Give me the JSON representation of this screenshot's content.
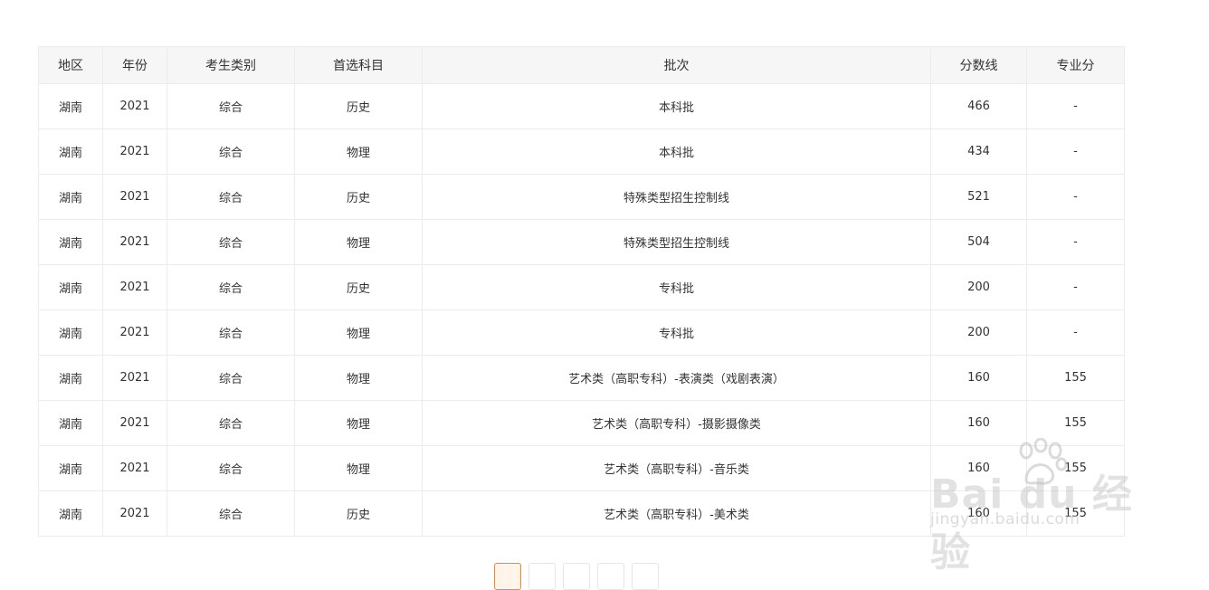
{
  "table": {
    "headers": {
      "region": "地区",
      "year": "年份",
      "type": "考生类别",
      "subject": "首选科目",
      "batch": "批次",
      "score": "分数线",
      "major": "专业分"
    },
    "rows": [
      {
        "region": "湖南",
        "year": "2021",
        "type": "综合",
        "subject": "历史",
        "batch": "本科批",
        "score": "466",
        "major": "-"
      },
      {
        "region": "湖南",
        "year": "2021",
        "type": "综合",
        "subject": "物理",
        "batch": "本科批",
        "score": "434",
        "major": "-"
      },
      {
        "region": "湖南",
        "year": "2021",
        "type": "综合",
        "subject": "历史",
        "batch": "特殊类型招生控制线",
        "score": "521",
        "major": "-"
      },
      {
        "region": "湖南",
        "year": "2021",
        "type": "综合",
        "subject": "物理",
        "batch": "特殊类型招生控制线",
        "score": "504",
        "major": "-"
      },
      {
        "region": "湖南",
        "year": "2021",
        "type": "综合",
        "subject": "历史",
        "batch": "专科批",
        "score": "200",
        "major": "-"
      },
      {
        "region": "湖南",
        "year": "2021",
        "type": "综合",
        "subject": "物理",
        "batch": "专科批",
        "score": "200",
        "major": "-"
      },
      {
        "region": "湖南",
        "year": "2021",
        "type": "综合",
        "subject": "物理",
        "batch": "艺术类（高职专科）-表演类（戏剧表演）",
        "score": "160",
        "major": "155"
      },
      {
        "region": "湖南",
        "year": "2021",
        "type": "综合",
        "subject": "物理",
        "batch": "艺术类（高职专科）-摄影摄像类",
        "score": "160",
        "major": "155"
      },
      {
        "region": "湖南",
        "year": "2021",
        "type": "综合",
        "subject": "物理",
        "batch": "艺术类（高职专科）-音乐类",
        "score": "160",
        "major": "155"
      },
      {
        "region": "湖南",
        "year": "2021",
        "type": "综合",
        "subject": "历史",
        "batch": "艺术类（高职专科）-美术类",
        "score": "160",
        "major": "155"
      }
    ]
  },
  "pagination": {
    "active_index": 0,
    "page_count_visible": 5,
    "active_color": "#f08a24"
  },
  "watermark": {
    "text": "Bai du 经验",
    "sub": "jingyan.baidu.com",
    "icon": "baidu-paw-icon"
  }
}
